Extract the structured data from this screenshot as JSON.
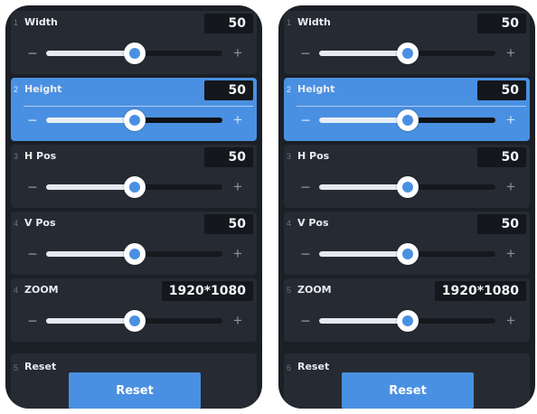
{
  "colors": {
    "panel": "#262b33",
    "background": "#1b1f26",
    "accent": "#4a90e2",
    "value_box": "#14171c"
  },
  "icons": {
    "minus": "−",
    "plus": "+"
  },
  "left_panel": {
    "rows": [
      {
        "num": "1",
        "label": "Width",
        "value": "50",
        "level": 0.5,
        "active": false
      },
      {
        "num": "2",
        "label": "Height",
        "value": "50",
        "level": 0.5,
        "active": true
      },
      {
        "num": "3",
        "label": "H Pos",
        "value": "50",
        "level": 0.5,
        "active": false
      },
      {
        "num": "4",
        "label": "V Pos",
        "value": "50",
        "level": 0.5,
        "active": false
      },
      {
        "num": "4",
        "label": "ZOOM",
        "value": "1920*1080",
        "level": 0.5,
        "active": false
      }
    ],
    "reset": {
      "num": "5",
      "label": "Reset",
      "button": "Reset"
    }
  },
  "right_panel": {
    "rows": [
      {
        "num": "1",
        "label": "Width",
        "value": "50",
        "level": 0.5,
        "active": false
      },
      {
        "num": "2",
        "label": "Height",
        "value": "50",
        "level": 0.5,
        "active": true
      },
      {
        "num": "3",
        "label": "H Pos",
        "value": "50",
        "level": 0.5,
        "active": false
      },
      {
        "num": "4",
        "label": "V Pos",
        "value": "50",
        "level": 0.5,
        "active": false
      },
      {
        "num": "5",
        "label": "ZOOM",
        "value": "1920*1080",
        "level": 0.5,
        "active": false
      }
    ],
    "reset": {
      "num": "6",
      "label": "Reset",
      "button": "Reset"
    }
  }
}
